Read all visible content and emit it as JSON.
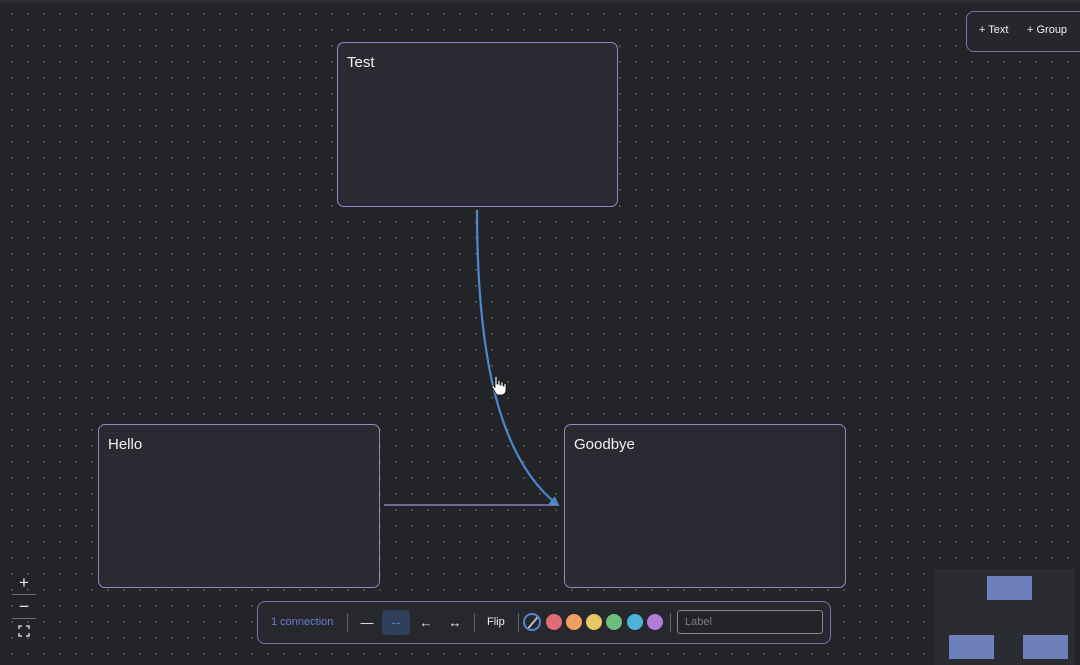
{
  "canvas": {
    "nodes": [
      {
        "id": "test",
        "title": "Test"
      },
      {
        "id": "hello",
        "title": "Hello"
      },
      {
        "id": "goodbye",
        "title": "Goodbye"
      }
    ],
    "edges": [
      {
        "from": "test",
        "to": "goodbye",
        "color": "#4c88cf",
        "selected": true
      },
      {
        "from": "hello",
        "to": "goodbye",
        "color": "#8d7db8",
        "selected": false
      }
    ]
  },
  "add_panel": {
    "text_label": "+ Text",
    "group_label": "+ Group"
  },
  "zoom_controls": {
    "zoom_in_label": "+",
    "zoom_out_label": "−",
    "fit_icon": "fit-view-icon"
  },
  "toolbar": {
    "connection_count": "1 connection",
    "line_style_label": "—",
    "dashed_style_label": "--",
    "arrow_back_label": "←",
    "arrow_both_label": "↔",
    "flip_label": "Flip",
    "colors": [
      "none",
      "#e06c75",
      "#f0a060",
      "#e5c862",
      "#6cbf7c",
      "#4fb3d8",
      "#b27bd6"
    ],
    "selected_color": "none",
    "label_placeholder": "Label"
  },
  "colors": {
    "node_border": "#9b83c4",
    "selected_edge": "#4c88cf",
    "accent": "#6d7dcc"
  }
}
